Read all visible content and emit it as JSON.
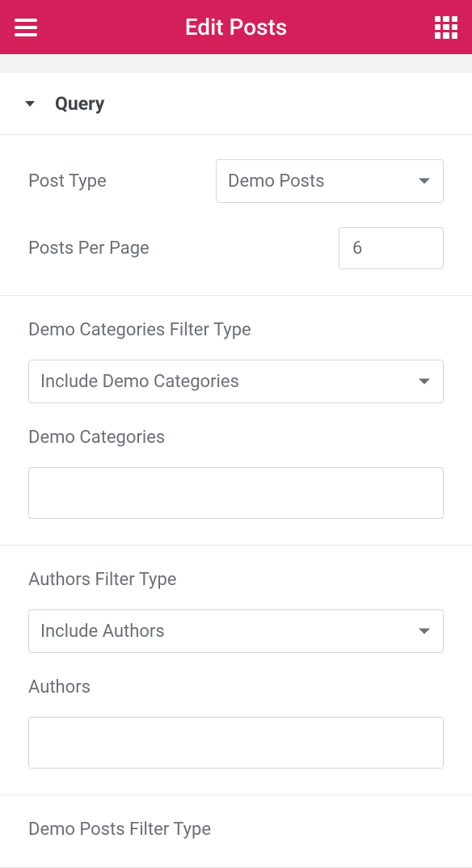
{
  "header": {
    "title": "Edit Posts"
  },
  "panel": {
    "title": "Query"
  },
  "postType": {
    "label": "Post Type",
    "value": "Demo Posts"
  },
  "postsPerPage": {
    "label": "Posts Per Page",
    "value": "6"
  },
  "demoCategoriesFilterType": {
    "label": "Demo Categories Filter Type",
    "value": "Include Demo Categories"
  },
  "demoCategories": {
    "label": "Demo Categories"
  },
  "authorsFilterType": {
    "label": "Authors Filter Type",
    "value": "Include Authors"
  },
  "authors": {
    "label": "Authors"
  },
  "demoPostsFilterType": {
    "label": "Demo Posts Filter Type"
  }
}
